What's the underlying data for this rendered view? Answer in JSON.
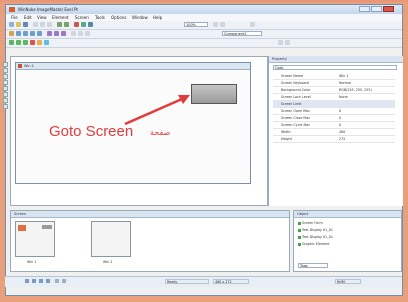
{
  "window": {
    "title": "WinNuke ImageMaster Exel Pt"
  },
  "menubar": {
    "items": [
      "File",
      "Edit",
      "View",
      "Element",
      "Screen",
      "Tools",
      "Options",
      "Window",
      "Help"
    ]
  },
  "toolbar": {
    "zoom": "100%",
    "component": "Component1"
  },
  "document": {
    "title": "Win 1"
  },
  "annotation": {
    "goto_text": "Goto Screen",
    "script_text": "ﺻﻔﺤﺔ"
  },
  "properties": {
    "title": "Property",
    "selector": "Goto",
    "rows": [
      {
        "k": "Screen Name",
        "v": "Win 1",
        "cat": false
      },
      {
        "k": "Screen Keyboard",
        "v": "Normal",
        "cat": false
      },
      {
        "k": "Background Color",
        "v": "RGB(255, 255, 255)",
        "cat": false
      },
      {
        "k": "Screen Lock Level",
        "v": "None",
        "cat": false
      },
      {
        "k": "Screen Limit",
        "v": "",
        "cat": true
      },
      {
        "k": "Screen Open Mac",
        "v": "0",
        "cat": false
      },
      {
        "k": "Screen Close Mac",
        "v": "0",
        "cat": false
      },
      {
        "k": "Screen Cycle Mac",
        "v": "0",
        "cat": false
      },
      {
        "k": "Width",
        "v": "480",
        "cat": false
      },
      {
        "k": "Height",
        "v": "272",
        "cat": false
      }
    ]
  },
  "screens_panel": {
    "title": "Screen",
    "thumbs": [
      "Win 1",
      "Win 2"
    ]
  },
  "right_panel": {
    "title": "Object",
    "rows": [
      "Screen Form",
      "Text Display 01_01",
      "Text Display 01_01",
      "Graphic Element"
    ],
    "tab": "Tags"
  },
  "statusbar": {
    "fields": [
      "Ready",
      "480 x 272",
      "NUM"
    ]
  },
  "colors": {
    "frame": "#e9a07a",
    "annotation_red": "#e23b3b"
  }
}
